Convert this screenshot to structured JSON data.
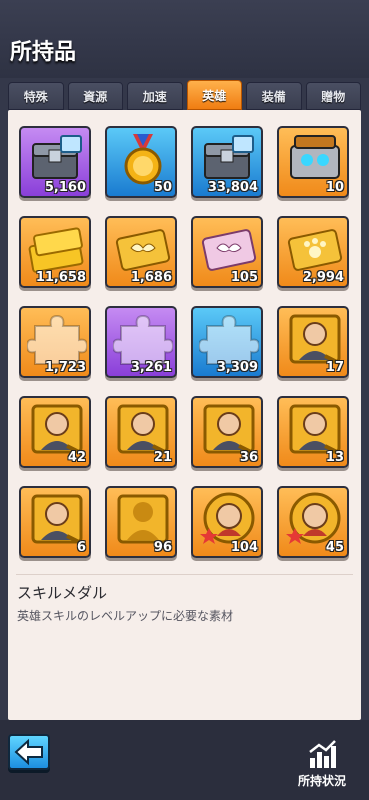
{
  "header": {
    "title": "所持品"
  },
  "tabs": [
    {
      "label": "特殊"
    },
    {
      "label": "資源"
    },
    {
      "label": "加速"
    },
    {
      "label": "英雄",
      "active": true
    },
    {
      "label": "装備"
    },
    {
      "label": "贈物"
    }
  ],
  "items": [
    {
      "name": "exp-chest-item",
      "icon": "exp-chest-icon",
      "rarity": "purple",
      "qty": "5,160"
    },
    {
      "name": "medal-item",
      "icon": "medal-icon",
      "rarity": "blue",
      "qty": "50"
    },
    {
      "name": "exp-chest-item-blue",
      "icon": "exp-chest-icon",
      "rarity": "blue",
      "qty": "33,804"
    },
    {
      "name": "robot-chest-item",
      "icon": "robot-chest-icon",
      "rarity": "orange",
      "qty": "10"
    },
    {
      "name": "gold-bars-item",
      "icon": "gold-bars-icon",
      "rarity": "orange",
      "qty": "11,658"
    },
    {
      "name": "wing-card-item",
      "icon": "gold-wing-card-icon",
      "rarity": "orange",
      "qty": "1,686"
    },
    {
      "name": "pink-wing-card-item",
      "icon": "pink-wing-card-icon",
      "rarity": "orange",
      "qty": "105"
    },
    {
      "name": "paw-card-item",
      "icon": "paw-card-icon",
      "rarity": "orange",
      "qty": "2,994"
    },
    {
      "name": "orange-puzzle-item",
      "icon": "puzzle-piece-icon",
      "rarity": "orange",
      "qty": "1,723"
    },
    {
      "name": "purple-puzzle-item",
      "icon": "puzzle-piece-icon",
      "rarity": "purple",
      "qty": "3,261"
    },
    {
      "name": "blue-puzzle-item",
      "icon": "puzzle-piece-icon",
      "rarity": "blue",
      "qty": "3,309"
    },
    {
      "name": "hero-shard-blonde-woman-item",
      "icon": "hero-portrait-icon",
      "rarity": "orange",
      "qty": "17"
    },
    {
      "name": "hero-shard-old-man-item",
      "icon": "hero-portrait-icon",
      "rarity": "orange",
      "qty": "42"
    },
    {
      "name": "hero-shard-dark-man-item",
      "icon": "hero-portrait-icon",
      "rarity": "orange",
      "qty": "21"
    },
    {
      "name": "hero-shard-bearded-man-item",
      "icon": "hero-portrait-icon",
      "rarity": "orange",
      "qty": "36"
    },
    {
      "name": "hero-shard-glasses-man-item",
      "icon": "hero-portrait-icon",
      "rarity": "orange",
      "qty": "13"
    },
    {
      "name": "hero-shard-curly-woman-item",
      "icon": "hero-portrait-icon",
      "rarity": "orange",
      "qty": "6"
    },
    {
      "name": "hero-shard-gold-silhouette-item",
      "icon": "hero-silhouette-icon",
      "rarity": "orange",
      "qty": "96"
    },
    {
      "name": "hero-token-cowgirl-item",
      "icon": "hero-token-star-icon",
      "rarity": "orange",
      "qty": "104"
    },
    {
      "name": "hero-token-brunette-item",
      "icon": "hero-token-star-icon",
      "rarity": "orange",
      "qty": "45"
    }
  ],
  "description": {
    "title": "スキルメダル",
    "text": "英雄スキルのレベルアップに必要な素材"
  },
  "footer": {
    "back_icon": "left-arrow-icon",
    "status_icon": "bar-chart-icon",
    "status_label": "所持状況"
  },
  "colors": {
    "accent": "#f08a1a",
    "purple": "#8a3fd9",
    "blue": "#1a7bd0",
    "orange": "#f08a1a"
  }
}
